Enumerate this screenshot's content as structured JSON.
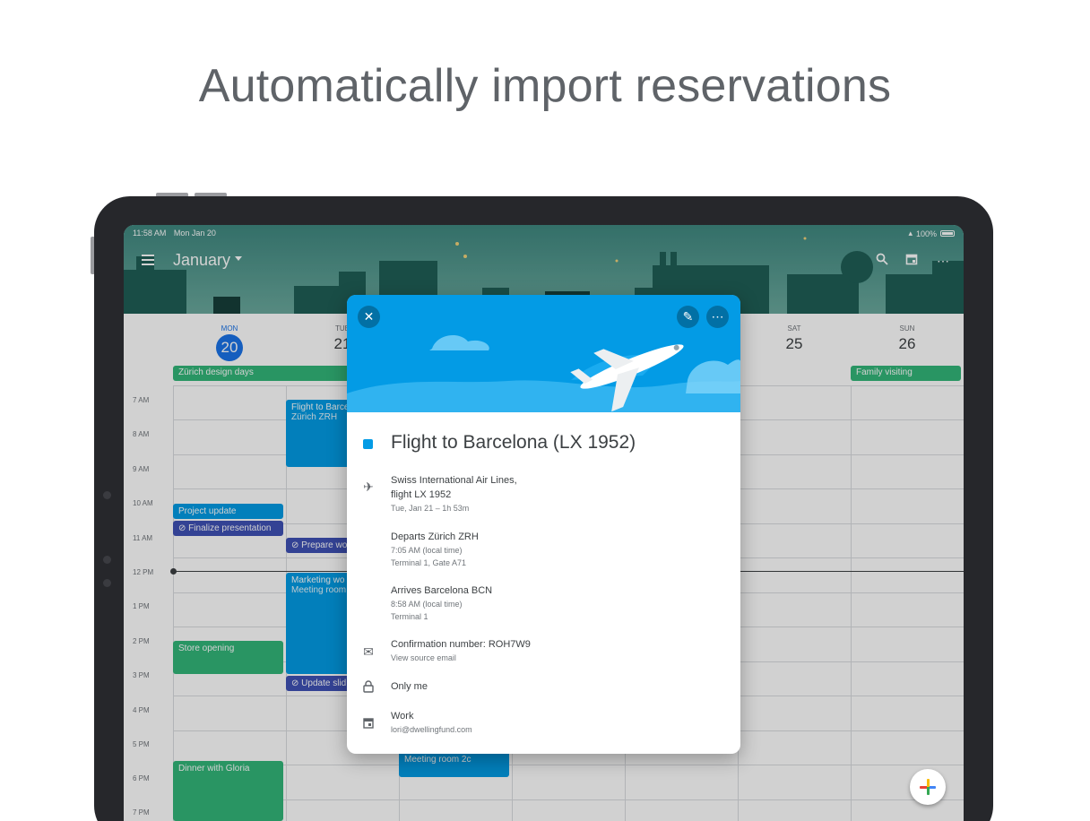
{
  "headline": "Automatically import reservations",
  "status": {
    "time": "11:58 AM",
    "date": "Mon Jan 20",
    "battery": "100%"
  },
  "header": {
    "month": "January"
  },
  "days": [
    {
      "dow": "MON",
      "num": "20"
    },
    {
      "dow": "TUE",
      "num": "21"
    },
    {
      "dow": "",
      "num": ""
    },
    {
      "dow": "",
      "num": ""
    },
    {
      "dow": "",
      "num": ""
    },
    {
      "dow": "SAT",
      "num": "25"
    },
    {
      "dow": "SUN",
      "num": "26"
    }
  ],
  "allday": {
    "zurich": "Zürich design days",
    "family": "Family visiting"
  },
  "hours": [
    "7 AM",
    "8 AM",
    "9 AM",
    "10 AM",
    "11 AM",
    "12 PM",
    "1 PM",
    "2 PM",
    "3 PM",
    "4 PM",
    "5 PM",
    "6 PM",
    "7 PM"
  ],
  "events": {
    "flight_title": "Flight to Barce",
    "flight_sub": "Zürich ZRH",
    "project_update": "Project update",
    "finalize": "Finalize presentation",
    "prepare": "Prepare wo",
    "marketing_title": "Marketing wo",
    "marketing_sub": "Meeting room",
    "update_slides": "Update slid",
    "store_opening": "Store opening",
    "dinner": "Dinner with Gloria",
    "meeting_2c": "Meeting room 2c"
  },
  "card": {
    "title": "Flight to Barcelona (LX 1952)",
    "airline_line1": "Swiss International Air Lines,",
    "airline_line2": "flight LX 1952",
    "airline_sub": "Tue, Jan 21 – 1h 53m",
    "depart_title": "Departs Zürich ZRH",
    "depart_time": "7:05 AM (local time)",
    "depart_gate": "Terminal 1, Gate A71",
    "arrive_title": "Arrives Barcelona BCN",
    "arrive_time": "8:58 AM (local time)",
    "arrive_terminal": "Terminal 1",
    "confirmation": "Confirmation number: ROH7W9",
    "view_source": "View source email",
    "visibility": "Only me",
    "calendar": "Work",
    "calendar_email": "lori@dwellingfund.com"
  },
  "colors": {
    "event_blue": "#039be5",
    "event_green": "#33b679",
    "task_indigo": "#3f51b5",
    "today_blue": "#1a73e8"
  },
  "icons": [
    "menu-icon",
    "search-icon",
    "calendar-icon",
    "more-icon",
    "close-icon",
    "edit-icon",
    "airplane-icon",
    "mail-icon",
    "lock-icon",
    "calendar-icon",
    "add-icon"
  ]
}
